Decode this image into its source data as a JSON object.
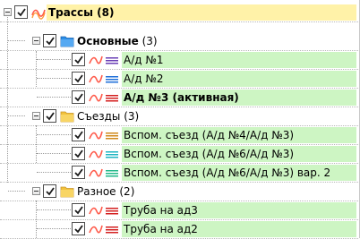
{
  "tree": {
    "root": {
      "label": "Трассы (8)"
    },
    "groups": [
      {
        "name": "Основные",
        "count": "(3)",
        "items": [
          {
            "label": "А/д №1",
            "line_color": "#6a3fb5"
          },
          {
            "label": "А/д №2",
            "line_color": "#1e6fd9"
          },
          {
            "label": "А/д №3 (активная)",
            "line_color": "#d42020"
          }
        ]
      },
      {
        "name": "Съезды",
        "count": "(3)",
        "items": [
          {
            "label": "Вспом. съезд (А/д №4/А/д №3)",
            "line_color": "#d08a1c"
          },
          {
            "label": "Вспом. съезд (А/д №6/А/д №3)",
            "line_color": "#1fb5c2"
          },
          {
            "label": "Вспом. съезд (А/д №6/А/д №3) вар. 2",
            "line_color": "#22b88a"
          }
        ]
      },
      {
        "name": "Разное",
        "count": "(2)",
        "items": [
          {
            "label": "Труба на ад3",
            "line_color": "#d42020"
          },
          {
            "label": "Труба на ад2",
            "line_color": "#d42020"
          }
        ]
      }
    ]
  },
  "colors": {
    "root_highlight": "#fff2a8",
    "item_highlight": "#cdf5c3",
    "route_icon": "#ff5a4a",
    "folder_blue": "#2b8fe8",
    "folder_yellow": "#f2c23c"
  }
}
